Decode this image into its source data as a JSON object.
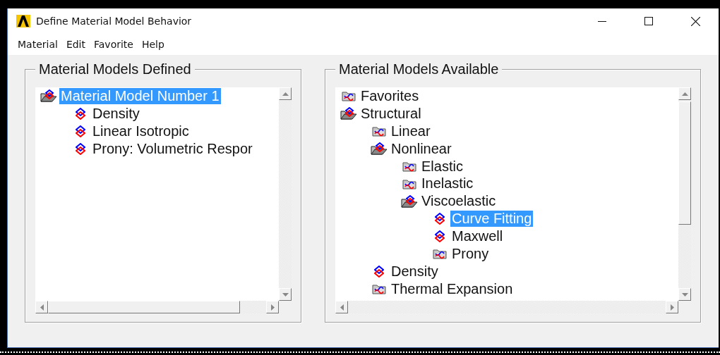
{
  "window": {
    "title": "Define Material Model Behavior"
  },
  "menu": [
    "Material",
    "Edit",
    "Favorite",
    "Help"
  ],
  "defined_panel": {
    "title": "Material Models Defined",
    "tree": [
      {
        "label": "Material Model Number 1",
        "kind": "folder-open",
        "selected": true,
        "children": [
          {
            "label": "Density",
            "kind": "model",
            "selected": false
          },
          {
            "label": "Linear Isotropic",
            "kind": "model",
            "selected": false
          },
          {
            "label": "Prony: Volumetric Respor",
            "kind": "model",
            "selected": false
          }
        ]
      }
    ]
  },
  "available_panel": {
    "title": "Material Models Available",
    "tree": [
      {
        "label": "Favorites",
        "kind": "folder",
        "selected": false
      },
      {
        "label": "Structural",
        "kind": "folder-open",
        "selected": false,
        "children": [
          {
            "label": "Linear",
            "kind": "folder",
            "selected": false
          },
          {
            "label": "Nonlinear",
            "kind": "folder-open",
            "selected": false,
            "children": [
              {
                "label": "Elastic",
                "kind": "folder",
                "selected": false
              },
              {
                "label": "Inelastic",
                "kind": "folder",
                "selected": false
              },
              {
                "label": "Viscoelastic",
                "kind": "folder-open",
                "selected": false,
                "children": [
                  {
                    "label": "Curve Fitting",
                    "kind": "model",
                    "selected": true
                  },
                  {
                    "label": "Maxwell",
                    "kind": "model",
                    "selected": false
                  },
                  {
                    "label": "Prony",
                    "kind": "folder",
                    "selected": false
                  }
                ]
              }
            ]
          },
          {
            "label": "Density",
            "kind": "model",
            "selected": false
          },
          {
            "label": "Thermal Expansion",
            "kind": "folder",
            "selected": false
          }
        ]
      }
    ]
  }
}
